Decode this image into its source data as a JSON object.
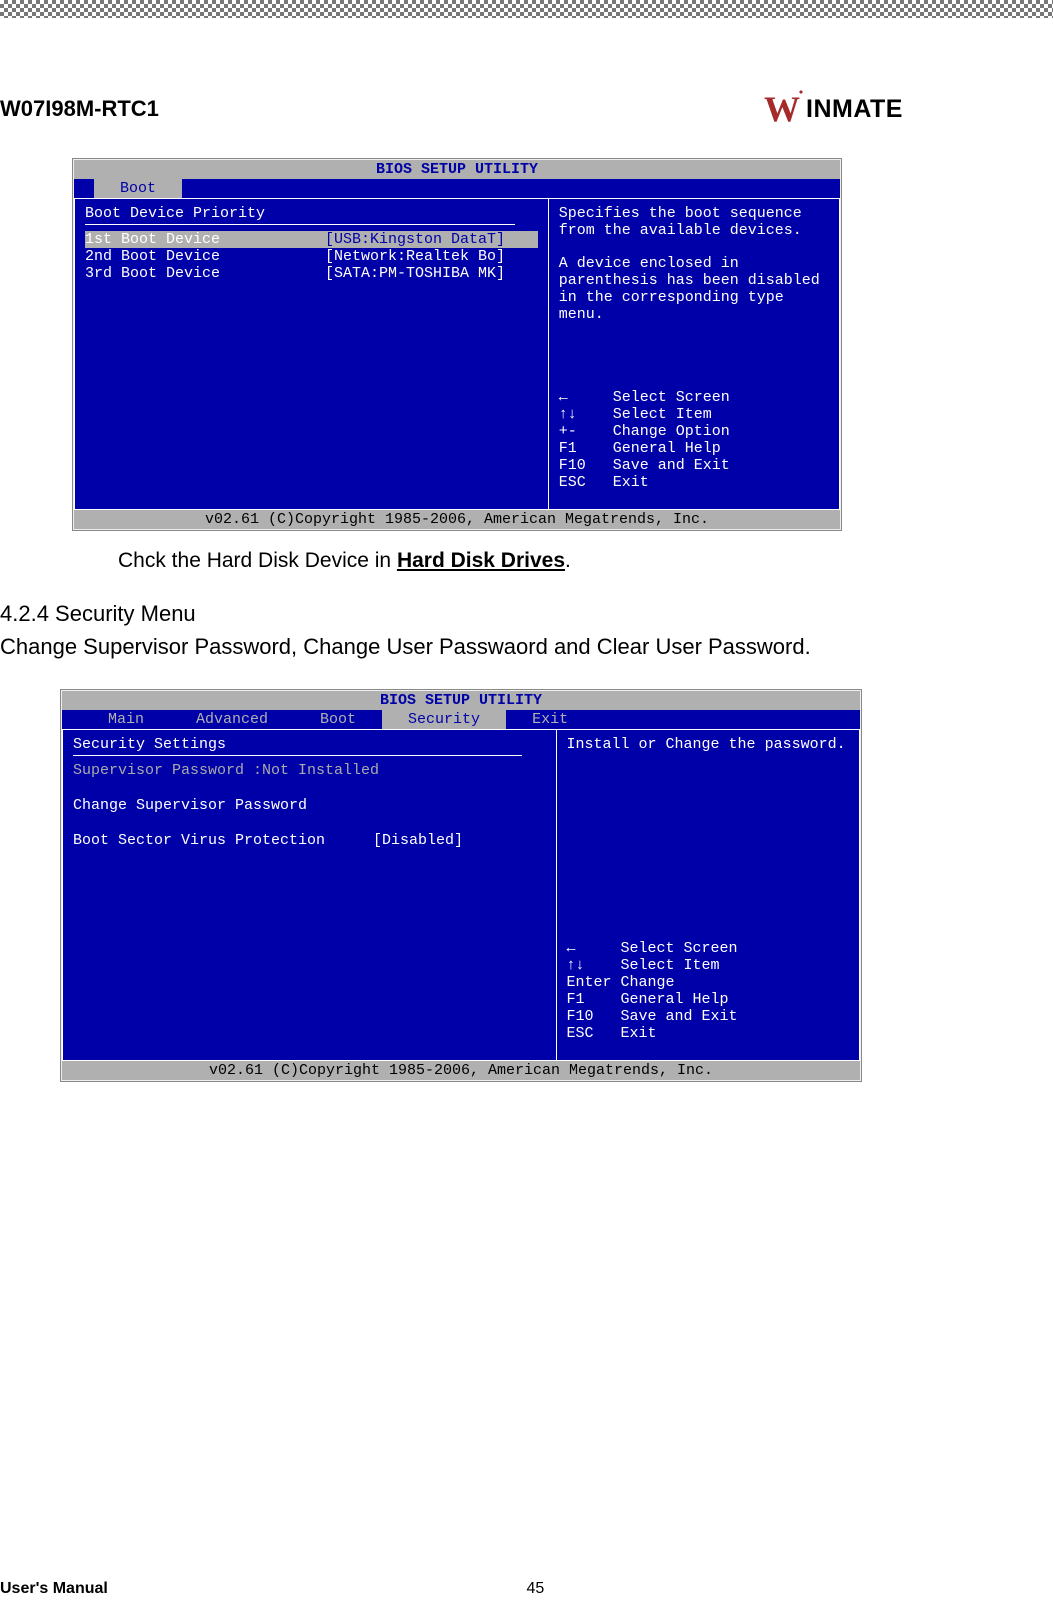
{
  "header": {
    "product_name": "W07I98M-RTC1",
    "brand_prefix": "W",
    "brand_rest": "INMATE"
  },
  "bios1": {
    "title": "BIOS SETUP UTILITY",
    "active_tab": "Boot",
    "section_title": "Boot Device Priority",
    "rows": [
      {
        "key": "1st Boot Device",
        "val": "[USB:Kingston DataT]"
      },
      {
        "key": "2nd Boot Device",
        "val": "[Network:Realtek Bo]"
      },
      {
        "key": "3rd Boot Device",
        "val": "[SATA:PM-TOSHIBA MK]"
      }
    ],
    "help_desc1": "Specifies the boot sequence from the available devices.",
    "help_desc2": "A device enclosed in parenthesis has been disabled in the corresponding type menu.",
    "help_keys": [
      {
        "k": "←",
        "v": "Select Screen"
      },
      {
        "k": "↑↓",
        "v": "Select Item"
      },
      {
        "k": "+-",
        "v": "Change Option"
      },
      {
        "k": "F1",
        "v": "General Help"
      },
      {
        "k": "F10",
        "v": "Save and Exit"
      },
      {
        "k": "ESC",
        "v": "Exit"
      }
    ],
    "copyright": "v02.61 (C)Copyright 1985-2006, American Megatrends, Inc."
  },
  "below_bios1": {
    "prefix": "Chck the Hard Disk Device in ",
    "link": "Hard Disk Drives",
    "suffix": "."
  },
  "section": {
    "heading": "4.2.4 Security Menu",
    "body": "Change Supervisor Password, Change User Passwaord and Clear User Password."
  },
  "bios2": {
    "title": "BIOS SETUP UTILITY",
    "tabs": [
      "Main",
      "Advanced",
      "Boot",
      "Security",
      "Exit"
    ],
    "active_tab": "Security",
    "section_title": "Security Settings",
    "supervisor_status_label": "Supervisor Password :",
    "supervisor_status_value": "Not Installed",
    "change_pw_label": "Change Supervisor Password",
    "bsvp_label": "Boot Sector Virus Protection",
    "bsvp_value": "[Disabled]",
    "help_desc": "Install or Change the password.",
    "help_keys": [
      {
        "k": "←",
        "v": "Select Screen"
      },
      {
        "k": "↑↓",
        "v": "Select Item"
      },
      {
        "k": "Enter",
        "v": "Change"
      },
      {
        "k": "F1",
        "v": "General Help"
      },
      {
        "k": "F10",
        "v": "Save and Exit"
      },
      {
        "k": "ESC",
        "v": "Exit"
      }
    ],
    "copyright": "v02.61 (C)Copyright 1985-2006, American Megatrends, Inc."
  },
  "footer": {
    "manual": "User's Manual",
    "page": "45"
  }
}
